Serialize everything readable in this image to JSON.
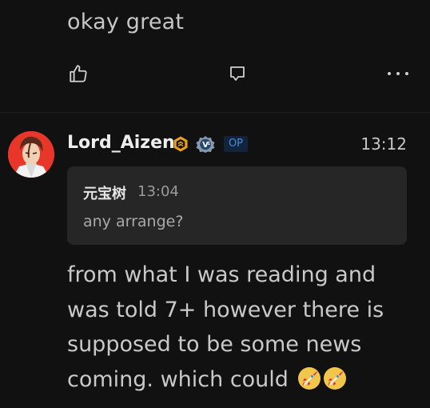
{
  "previous_comment": {
    "text": "okay great"
  },
  "actions": {
    "like_icon": "thumbs-up-icon",
    "reply_icon": "comment-bubble-icon",
    "more_icon": "more-dots-icon"
  },
  "comment": {
    "username": "Lord_Aizen",
    "op_badge": "OP",
    "time": "13:12",
    "quote": {
      "author": "元宝树",
      "time": "13:04",
      "text": "any arrange?"
    },
    "body_lines": [
      "from what I was reading and",
      "was told 7+ however there is",
      "supposed to be some news",
      "coming. which could"
    ],
    "emoji": [
      "rocket-icon",
      "rocket-icon"
    ]
  },
  "colors": {
    "background": "#111111",
    "quote_bg": "#262626",
    "op_bg": "#12243c",
    "op_text": "#4c8ad6",
    "level_badge": "#e8a21a",
    "avatar_bg": "#e8362b"
  }
}
